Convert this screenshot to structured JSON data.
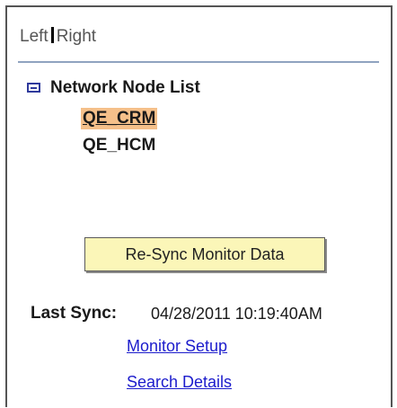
{
  "tabs": {
    "left_label": "Left",
    "right_label": "Right"
  },
  "tree": {
    "root_label": "Network Node List",
    "nodes": [
      {
        "label": "QE_CRM",
        "selected": true
      },
      {
        "label": "QE_HCM",
        "selected": false
      }
    ],
    "collapse_icon": "minus-box-icon"
  },
  "actions": {
    "resync_label": "Re-Sync Monitor Data"
  },
  "sync": {
    "label": "Last Sync:",
    "value": "04/28/2011 10:19:40AM"
  },
  "links": {
    "monitor_setup": "Monitor Setup",
    "search_details": "Search Details"
  },
  "colors": {
    "selected_node_bg": "#f5c08a",
    "button_bg": "#fbf6b8",
    "link": "#1c1ccc",
    "divider": "#8fa3c0",
    "icon": "#2f3a9c"
  }
}
